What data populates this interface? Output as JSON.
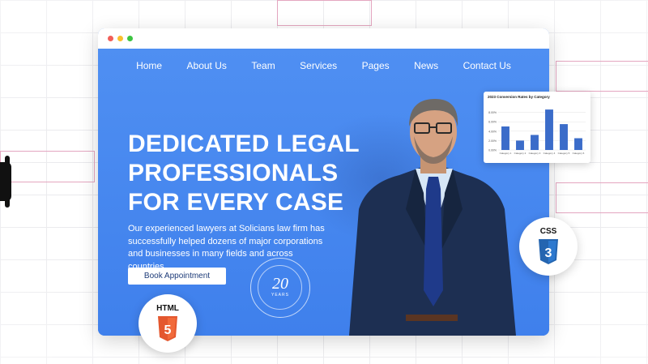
{
  "nav": {
    "items": [
      "Home",
      "About Us",
      "Team",
      "Services",
      "Pages",
      "News",
      "Contact Us"
    ]
  },
  "hero": {
    "headline_lines": [
      "DEDICATED LEGAL",
      "PROFESSIONALS",
      "FOR EVERY CASE"
    ],
    "subtext_lines": [
      "Our experienced lawyers at Solicians law firm has",
      "successfully helped dozens of major corporations",
      "and businesses in many fields and across countries."
    ],
    "cta_label": "Book Appointment",
    "badge_number": "20",
    "badge_word": "YEARS"
  },
  "chart_data": {
    "type": "bar",
    "title": "2023 Conversion Rates by Category",
    "categories": [
      "Category 1",
      "Category 2",
      "Category 3",
      "Category 4",
      "Category 5",
      "Category 6"
    ],
    "values": [
      5.0,
      2.0,
      3.2,
      8.6,
      5.5,
      2.5
    ],
    "ylim": [
      0,
      10
    ],
    "yticks": [
      "0.00%",
      "2.00%",
      "4.00%",
      "6.00%",
      "8.00%"
    ],
    "bar_color": "#3b6cc9"
  },
  "tech_badges": {
    "css_label": "CSS",
    "css_number": "3",
    "css_color": "#2465b0",
    "html_label": "HTML",
    "html_number": "5",
    "html_color": "#e4572e"
  },
  "colors": {
    "hero_blue": "#4a8af0",
    "suit_navy": "#1d2f52"
  }
}
